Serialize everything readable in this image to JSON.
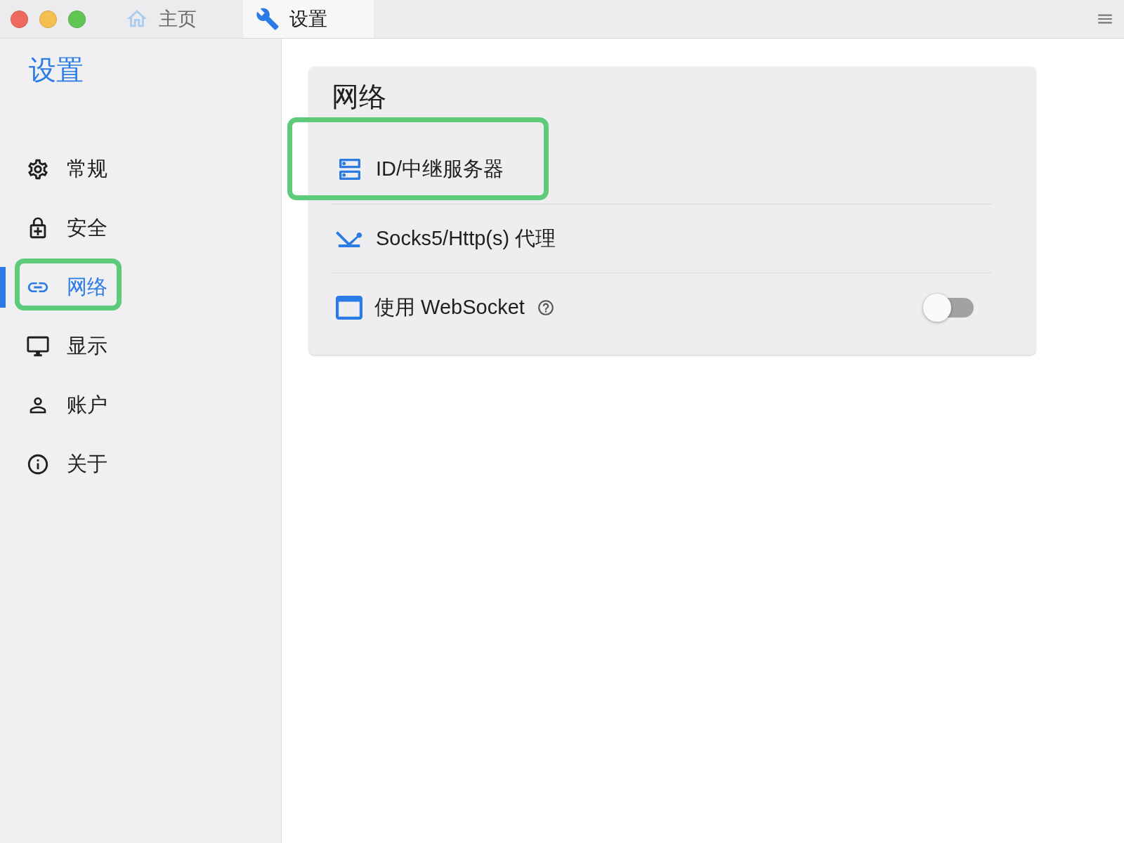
{
  "tabs": [
    {
      "label": "主页",
      "selected": false
    },
    {
      "label": "设置",
      "selected": true
    }
  ],
  "sidebar": {
    "title": "设置",
    "items": [
      {
        "label": "常规",
        "selected": false,
        "highlighted": false
      },
      {
        "label": "安全",
        "selected": false,
        "highlighted": false
      },
      {
        "label": "网络",
        "selected": true,
        "highlighted": true
      },
      {
        "label": "显示",
        "selected": false,
        "highlighted": false
      },
      {
        "label": "账户",
        "selected": false,
        "highlighted": false
      },
      {
        "label": "关于",
        "selected": false,
        "highlighted": false
      }
    ]
  },
  "panel": {
    "title": "网络",
    "rows": [
      {
        "kind": "link",
        "label": "ID/中继服务器",
        "highlighted": true
      },
      {
        "kind": "link",
        "label": "Socks5/Http(s) 代理",
        "highlighted": false
      },
      {
        "kind": "switch",
        "label": "使用 WebSocket",
        "help": true,
        "on": false,
        "highlighted": false
      }
    ]
  }
}
